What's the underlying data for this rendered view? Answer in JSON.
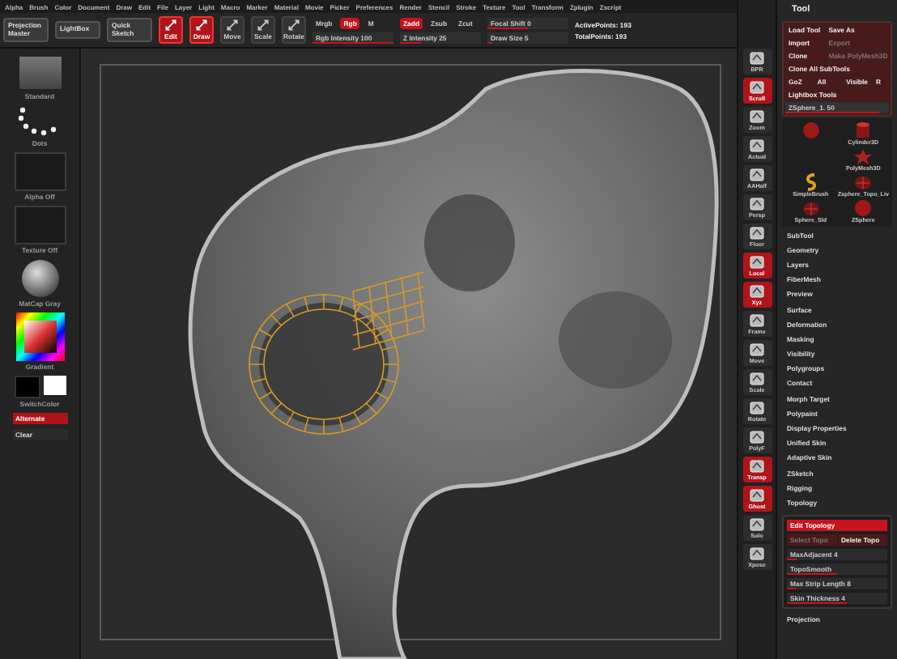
{
  "menu_bar": [
    "Alpha",
    "Brush",
    "Color",
    "Document",
    "Draw",
    "Edit",
    "File",
    "Layer",
    "Light",
    "Macro",
    "Marker",
    "Material",
    "Movie",
    "Picker",
    "Preferences",
    "Render",
    "Stencil",
    "Stroke",
    "Texture",
    "Tool",
    "Transform",
    "Zplugin",
    "Zscript"
  ],
  "top_shelf": [
    {
      "kind": "button",
      "label": "Projection Master"
    },
    {
      "kind": "button",
      "label": "LightBox"
    },
    {
      "kind": "button",
      "label": "Quick Sketch"
    },
    {
      "kind": "mode",
      "label": "Edit",
      "selected": true
    },
    {
      "kind": "mode",
      "label": "Draw",
      "selected": true
    },
    {
      "kind": "mode",
      "label": "Move",
      "selected": false
    },
    {
      "kind": "mode",
      "label": "Scale",
      "selected": false
    },
    {
      "kind": "mode",
      "label": "Rotate",
      "selected": false
    },
    {
      "kind": "pair",
      "toggles": [
        {
          "label": "Mrgb",
          "selected": false
        },
        {
          "label": "Rgb",
          "selected": true
        },
        {
          "label": "M",
          "selected": false
        }
      ],
      "slider": {
        "label": "Rgb Intensity",
        "value": "100",
        "level": 1
      }
    },
    {
      "kind": "pair",
      "toggles": [
        {
          "label": "Zadd",
          "selected": true
        },
        {
          "label": "Zsub",
          "selected": false
        },
        {
          "label": "Zcut",
          "selected": false
        }
      ],
      "slider": {
        "label": "Z Intensity",
        "value": "25",
        "level": 0.25
      }
    },
    {
      "kind": "sliders",
      "sliders": [
        {
          "label": "Focal Shift",
          "value": "0",
          "level": 0.5
        },
        {
          "label": "Draw Size",
          "value": "5",
          "level": 0.05
        }
      ]
    },
    {
      "kind": "stats",
      "lines": [
        "ActivePoints: 193",
        "TotalPoints: 193"
      ]
    }
  ],
  "left_shelf": [
    {
      "kind": "thumb",
      "label": "Standard"
    },
    {
      "kind": "dots",
      "label": "Dots"
    },
    {
      "kind": "empty",
      "label": "Alpha Off"
    },
    {
      "kind": "empty",
      "label": "Texture Off"
    },
    {
      "kind": "sphere",
      "label": "MatCap Gray"
    },
    {
      "kind": "picker",
      "label": "Gradient"
    },
    {
      "kind": "swatch",
      "label": "SwitchColor"
    },
    {
      "kind": "button",
      "label": "Alternate",
      "selected": true
    },
    {
      "kind": "button",
      "label": "Clear",
      "selected": false
    }
  ],
  "right_shelf": [
    {
      "label": "BPR",
      "selected": false
    },
    {
      "label": "Scroll",
      "selected": true
    },
    {
      "label": "Zoom",
      "selected": false
    },
    {
      "label": "Actual",
      "selected": false
    },
    {
      "label": "AAHalf",
      "selected": false
    },
    {
      "label": "Persp",
      "selected": false
    },
    {
      "label": "Floor",
      "selected": false
    },
    {
      "label": "Local",
      "selected": true
    },
    {
      "label": "Xyz",
      "selected": true
    },
    {
      "label": "Frame",
      "selected": false
    },
    {
      "label": "Move",
      "selected": false
    },
    {
      "label": "Scale",
      "selected": false
    },
    {
      "label": "Rotate",
      "selected": false
    },
    {
      "label": "PolyF",
      "selected": false
    },
    {
      "label": "Transp",
      "selected": true
    },
    {
      "label": "Ghost",
      "selected": true
    },
    {
      "label": "Solo",
      "selected": false
    },
    {
      "label": "Xpose",
      "selected": false
    }
  ],
  "tool_panel": {
    "title": "Tool",
    "buttons": [
      {
        "label": "Load Tool",
        "disabled": false
      },
      {
        "label": "Save As",
        "disabled": false
      },
      {
        "label": "Import",
        "disabled": false
      },
      {
        "label": "Export",
        "disabled": true
      },
      {
        "label": "Clone",
        "disabled": false
      },
      {
        "label": "Make PolyMesh3D",
        "disabled": true
      }
    ],
    "wide_buttons": [
      "Clone All SubTools"
    ],
    "goz_row": [
      "GoZ",
      "All",
      "Visible",
      "R"
    ],
    "lightbox_tools": "Lightbox Tools",
    "current_tool": {
      "label": "ZSphere_1. 50",
      "level": 0.9
    },
    "tools": [
      {
        "kind": "blob"
      },
      {
        "label": "Cylinder3D",
        "kind": "cylinder"
      },
      {
        "kind": "none"
      },
      {
        "label": "PolyMesh3D",
        "kind": "star"
      },
      {
        "label": "SimpleBrush",
        "kind": "brush"
      },
      {
        "label": "Zsphere_Topo_Liv",
        "kind": "mesh"
      },
      {
        "label": "Sphere_Sld",
        "kind": "mesh"
      },
      {
        "label": "ZSphere",
        "kind": "blob"
      }
    ],
    "subpalettes": [
      "SubTool",
      "Geometry",
      "Layers",
      "FiberMesh",
      "Preview",
      "Surface",
      "Deformation",
      "Masking",
      "Visibility",
      "Polygroups",
      "Contact",
      "Morph Target",
      "Polypaint",
      "Display Properties",
      "Unified Skin",
      "Adaptive Skin",
      "ZSketch",
      "Rigging",
      "Topology"
    ],
    "topology": {
      "edit": {
        "label": "Edit Topology",
        "selected": true
      },
      "select": {
        "label": "Select Topo",
        "disabled": true
      },
      "delete": {
        "label": "Delete Topo",
        "disabled": false
      },
      "sliders": [
        {
          "label": "MaxAdjacent 4",
          "level": 0.1
        },
        {
          "label": "TopoSmooth",
          "level": 0.5
        },
        {
          "label": "Max Strip Length 8",
          "level": 0.1
        },
        {
          "label": "Skin Thickness 4",
          "level": 0.6
        }
      ]
    },
    "after": [
      "Projection"
    ]
  }
}
